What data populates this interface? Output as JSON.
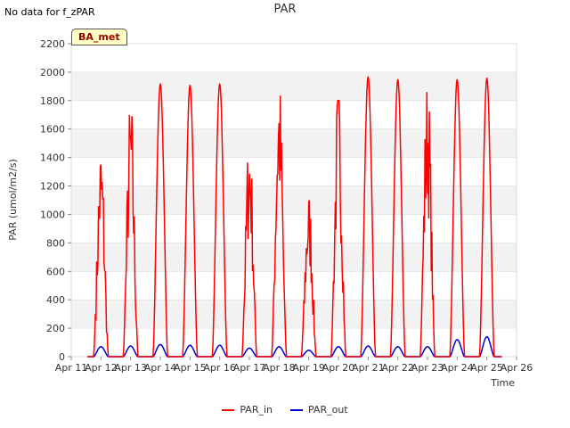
{
  "header": {
    "nodata_text": "No data for f_zPAR",
    "badge": "BA_met"
  },
  "chart_data": {
    "type": "line",
    "title": "PAR",
    "xlabel": "Time",
    "ylabel": "PAR (umol/m2/s)",
    "xlim": [
      "Apr 11",
      "Apr 26"
    ],
    "ylim": [
      0,
      2200
    ],
    "x_ticks": [
      "Apr 11",
      "Apr 12",
      "Apr 13",
      "Apr 14",
      "Apr 15",
      "Apr 16",
      "Apr 17",
      "Apr 18",
      "Apr 19",
      "Apr 20",
      "Apr 21",
      "Apr 22",
      "Apr 23",
      "Apr 24",
      "Apr 25",
      "Apr 26"
    ],
    "y_ticks": [
      0,
      200,
      400,
      600,
      800,
      1000,
      1200,
      1400,
      1600,
      1800,
      2000,
      2200
    ],
    "grid": "horizontal bands",
    "legend_position": "bottom",
    "series": [
      {
        "name": "PAR_in",
        "color": "#ff0000",
        "days": [
          {
            "day": "Apr 11",
            "peak": 1400,
            "noisy": true
          },
          {
            "day": "Apr 12",
            "peak": 1700,
            "noisy": true
          },
          {
            "day": "Apr 13",
            "peak": 1920,
            "noisy": false
          },
          {
            "day": "Apr 14",
            "peak": 1910,
            "noisy": false
          },
          {
            "day": "Apr 15",
            "peak": 1920,
            "noisy": false
          },
          {
            "day": "Apr 16",
            "peak": 1500,
            "noisy": true
          },
          {
            "day": "Apr 17",
            "peak": 1850,
            "noisy": true
          },
          {
            "day": "Apr 18",
            "peak": 1100,
            "noisy": true
          },
          {
            "day": "Apr 19",
            "peak": 1800,
            "noisy": true
          },
          {
            "day": "Apr 20",
            "peak": 1970,
            "noisy": false
          },
          {
            "day": "Apr 21",
            "peak": 1950,
            "noisy": false
          },
          {
            "day": "Apr 22",
            "peak": 1860,
            "noisy": true
          },
          {
            "day": "Apr 23",
            "peak": 1950,
            "noisy": false
          },
          {
            "day": "Apr 24",
            "peak": 1960,
            "noisy": false
          }
        ]
      },
      {
        "name": "PAR_out",
        "color": "#0000cc",
        "days": [
          {
            "day": "Apr 11",
            "peak": 70
          },
          {
            "day": "Apr 12",
            "peak": 75
          },
          {
            "day": "Apr 13",
            "peak": 85
          },
          {
            "day": "Apr 14",
            "peak": 80
          },
          {
            "day": "Apr 15",
            "peak": 80
          },
          {
            "day": "Apr 16",
            "peak": 60
          },
          {
            "day": "Apr 17",
            "peak": 70
          },
          {
            "day": "Apr 18",
            "peak": 45
          },
          {
            "day": "Apr 19",
            "peak": 70
          },
          {
            "day": "Apr 20",
            "peak": 75
          },
          {
            "day": "Apr 21",
            "peak": 70
          },
          {
            "day": "Apr 22",
            "peak": 70
          },
          {
            "day": "Apr 23",
            "peak": 120
          },
          {
            "day": "Apr 24",
            "peak": 140
          }
        ]
      }
    ]
  }
}
